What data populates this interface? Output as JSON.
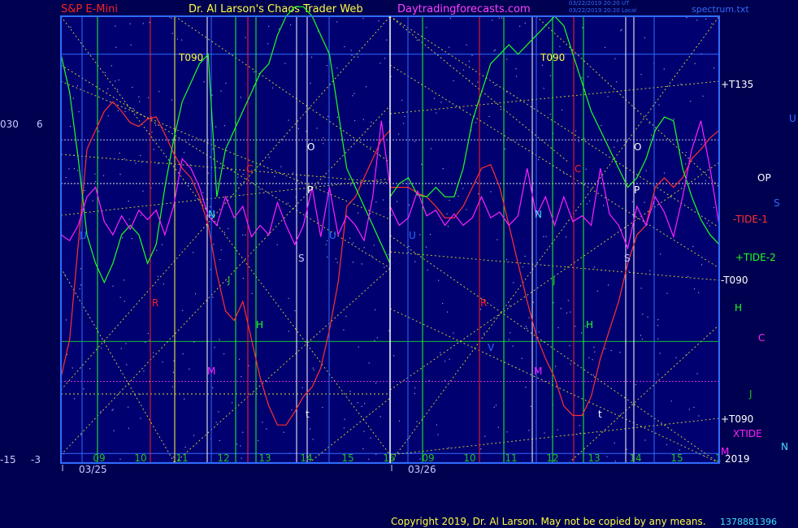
{
  "header": {
    "symbol": "S&P E-Mini",
    "site": "Dr. Al Larson's Chaos Trader Web",
    "url": "Daytradingforecasts.com",
    "update_line1": "03/22/2019 20:20 UT",
    "update_line2": "03/22/2019 20:20 Local",
    "spectrum_file": "spectrum.txt"
  },
  "footer": {
    "copyright": "Copyright 2019, Dr. Al Larson. May not be copied by any means.",
    "code": "1378881396"
  },
  "colors": {
    "background": "#000050",
    "plot_bg": "#000070",
    "red": "#ff2020",
    "green": "#20ff20",
    "magenta": "#ff20ff",
    "yellow": "#ffff20",
    "white": "#ffffff",
    "blue": "#2f6cff",
    "cyan": "#40e0ff"
  },
  "chart_data": {
    "type": "line",
    "days": [
      {
        "date": "03/25",
        "hours": [
          "09",
          "10",
          "11",
          "12",
          "13",
          "14",
          "15",
          "16"
        ]
      },
      {
        "date": "03/26",
        "hours": [
          "09",
          "10",
          "11",
          "12",
          "13",
          "14",
          "15",
          "1"
        ]
      }
    ],
    "left_axis": {
      "top": "030",
      "top2": "6",
      "bottom": "-15",
      "bottom2": "-3"
    },
    "right_labels": [
      {
        "text": "+T135",
        "color": "#ffffff"
      },
      {
        "text": "OP",
        "color": "#ffffff"
      },
      {
        "text": "-TIDE-1",
        "color": "#ff3030"
      },
      {
        "text": "+TIDE-2",
        "color": "#20ff20"
      },
      {
        "text": "-T090",
        "color": "#ffffff"
      },
      {
        "text": "H",
        "color": "#20ff20"
      },
      {
        "text": "C",
        "color": "#ff20ff"
      },
      {
        "text": "J",
        "color": "#20c020"
      },
      {
        "text": "+T090",
        "color": "#ffffff"
      },
      {
        "text": "XTIDE",
        "color": "#ff20ff"
      },
      {
        "text": "M",
        "color": "#ff20ff"
      },
      {
        "text": "2019",
        "color": "#ffffff"
      }
    ],
    "far_right_labels": [
      {
        "text": "U",
        "color": "#2f6cff"
      },
      {
        "text": "S",
        "color": "#2f6cff"
      },
      {
        "text": "N",
        "color": "#40e0ff"
      }
    ],
    "markers": {
      "t090": "T090",
      "o": "O",
      "p": "P",
      "s": "S",
      "u": "U",
      "n": "N",
      "j": "J",
      "h": "H",
      "m": "M",
      "r": "R",
      "c": "C",
      "v": "V",
      "t": "t"
    },
    "series": [
      {
        "name": "-TIDE-1",
        "color": "#ff3030",
        "day1": [
          -11,
          -9,
          -4,
          1,
          2,
          3,
          3.5,
          3,
          2.4,
          2.2,
          2.6,
          2.7,
          1.8,
          0.8,
          0,
          -0.5,
          -1.5,
          -3,
          -5.5,
          -7.5,
          -8,
          -7,
          -9,
          -11,
          -12.5,
          -13.5,
          -13.5,
          -12.8,
          -12,
          -11.5,
          -10.5,
          -8.5,
          -6,
          -2,
          -1.5,
          -0.5,
          0.5,
          1.5,
          2
        ],
        "day2": [
          -1,
          -1,
          -1,
          -1.3,
          -1.5,
          -2,
          -2.6,
          -2.6,
          -2,
          -1,
          0,
          0.2,
          -1,
          -3,
          -5,
          -7,
          -8.8,
          -10,
          -11,
          -12.5,
          -13,
          -13,
          -12,
          -10,
          -8.5,
          -7,
          -5,
          -3.5,
          -3,
          -1,
          -0.5,
          -1,
          -0.5,
          0.5,
          1,
          1.6,
          2
        ]
      },
      {
        "name": "+TIDE-2",
        "color": "#20ff20",
        "day1": [
          6,
          4,
          0.5,
          -3.5,
          -5,
          -6,
          -5,
          -3.5,
          -3,
          -3.5,
          -5,
          -4,
          -1,
          1.5,
          3.5,
          4.5,
          5.5,
          6,
          -1.5,
          1,
          2,
          3,
          4,
          5,
          5.5,
          7,
          8,
          8.5,
          8.5,
          8,
          7,
          6,
          3,
          0,
          -1,
          -2,
          -3,
          -4,
          -5
        ],
        "day2": [
          -1.5,
          -0.8,
          -0.5,
          -1.4,
          -1.5,
          -1,
          -1.5,
          -1.5,
          0,
          2.5,
          4,
          5.5,
          6,
          6.5,
          6,
          6.5,
          7,
          7.5,
          8,
          7.5,
          6,
          4.5,
          3,
          2,
          1,
          0,
          -1,
          -0.5,
          0.5,
          2,
          2.7,
          2.5,
          0,
          -1.5,
          -2.7,
          -3.5,
          -4
        ]
      },
      {
        "name": "XTIDE",
        "color": "#ff20ff",
        "day1": [
          -3.5,
          -3.8,
          -3,
          -1.5,
          -1,
          -2.8,
          -3.5,
          -2.5,
          -3.2,
          -2.2,
          -2.7,
          -2.2,
          -3.5,
          -2,
          0.5,
          0,
          -1,
          -2.5,
          -3,
          -1.5,
          -2.6,
          -2,
          -3.6,
          -3,
          -3.5,
          -1.8,
          -3,
          -4,
          -3,
          -1,
          -3.6,
          -1,
          -3.5,
          -2.5,
          -3,
          -3.8,
          -1.5,
          2.5,
          -1
        ],
        "day2": [
          -2,
          -3,
          -2.6,
          -1.2,
          -2.5,
          -2.2,
          -3,
          -2.4,
          -3,
          -2.6,
          -1.5,
          -2.6,
          -2.3,
          -3,
          -2.5,
          0,
          -2.5,
          -1.5,
          -3,
          -1.5,
          -2.8,
          -2.5,
          -3,
          0,
          -2.4,
          -3,
          -4.2,
          -2,
          -3,
          -1.5,
          -2.3,
          -3.6,
          -1.5,
          1,
          2.5,
          0,
          -3
        ]
      }
    ]
  }
}
